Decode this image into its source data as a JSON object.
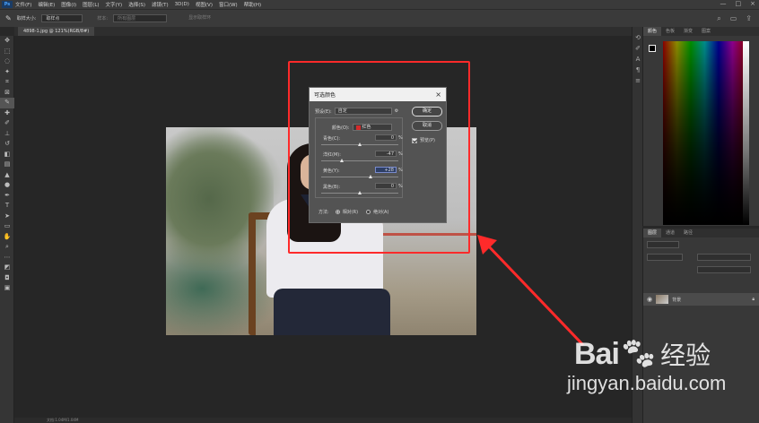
{
  "menubar": {
    "logo": "Ps",
    "items": [
      "文件(F)",
      "编辑(E)",
      "图像(I)",
      "图层(L)",
      "文字(Y)",
      "选择(S)",
      "滤镜(T)",
      "3D(D)",
      "视图(V)",
      "窗口(W)",
      "帮助(H)"
    ],
    "window_controls": [
      "—",
      "□",
      "×"
    ]
  },
  "options_bar": {
    "sample_label": "取样大小:",
    "sample_value": "取样点",
    "dim1": "样本:",
    "dim1_value": "所有图层",
    "dim2": "显示取样环"
  },
  "document_tab": {
    "label": "4898-1.jpg @ 121%(RGB/8#)"
  },
  "dialog": {
    "title": "可选颜色",
    "preset_label": "预设(E):",
    "preset_value": "自定",
    "colors_label": "颜色(O):",
    "colors_value": "红色",
    "ok_label": "确定",
    "cancel_label": "取消",
    "preview_label": "预览(P)",
    "preview_checked": true,
    "sliders": [
      {
        "label": "青色(C):",
        "value": "0",
        "unit": "%",
        "fraction": 0.5,
        "active": false
      },
      {
        "label": "洋红(M):",
        "value": "-47",
        "unit": "%",
        "fraction": 0.265,
        "active": false
      },
      {
        "label": "黄色(Y):",
        "value": "+28",
        "unit": "%",
        "fraction": 0.64,
        "active": true
      },
      {
        "label": "黑色(B):",
        "value": "0",
        "unit": "%",
        "fraction": 0.5,
        "active": false
      }
    ],
    "method_label": "方法:",
    "method_relative": "相对(R)",
    "method_absolute": "绝对(A)",
    "method_selected": "relative"
  },
  "color_panel": {
    "tabs": [
      "颜色",
      "色板",
      "渐变",
      "图案"
    ],
    "active_tab": 0
  },
  "layers_panel": {
    "tabs": [
      "图层",
      "通道",
      "路径"
    ],
    "active_tab": 0,
    "layer_name": "背景"
  },
  "status": {
    "text": "文档:1.04M/1.04M"
  },
  "watermark": {
    "logo": "Bai",
    "logo2": "经验",
    "url": "jingyan.baidu.com"
  },
  "colors": {
    "highlight": "#ff2a2a",
    "ps_blue": "#4aa3ff"
  }
}
